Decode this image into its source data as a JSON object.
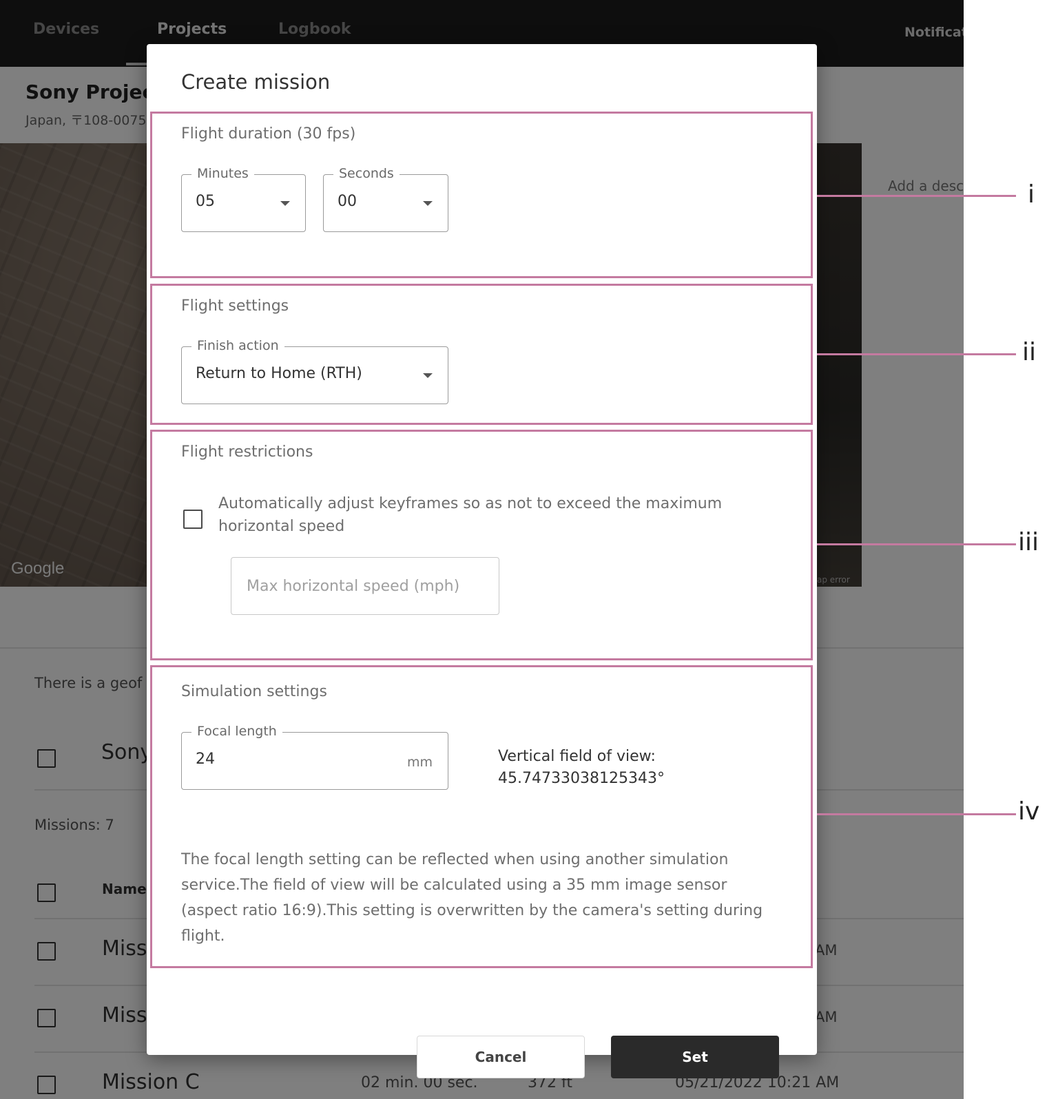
{
  "nav": {
    "tabs": [
      {
        "label": "Devices"
      },
      {
        "label": "Projects"
      },
      {
        "label": "Logbook"
      }
    ],
    "notifications": "Notificat"
  },
  "project": {
    "title": "Sony Project",
    "address": "Japan, 〒108-0075",
    "add_description": "Add a desc",
    "map_google": "Google",
    "map_error": "ap error"
  },
  "background_list": {
    "geofence_notice": "There is a geof",
    "sony_row": "Sony",
    "missions_count": "Missions: 7",
    "name_header": "Name",
    "rows": [
      {
        "name": "Miss",
        "time_suffix": "AM"
      },
      {
        "name": "Miss",
        "time_suffix": "AM"
      },
      {
        "name": "Mission C",
        "duration": "02 min. 00 sec.",
        "altitude": "372 ft",
        "date": "05/21/2022 10:21 AM"
      }
    ]
  },
  "dialog": {
    "title": "Create mission",
    "flight_duration": {
      "title": "Flight duration (30 fps)",
      "minutes_label": "Minutes",
      "minutes_value": "05",
      "seconds_label": "Seconds",
      "seconds_value": "00"
    },
    "flight_settings": {
      "title": "Flight settings",
      "finish_action_label": "Finish action",
      "finish_action_value": "Return to Home (RTH)"
    },
    "flight_restrictions": {
      "title": "Flight restrictions",
      "adjust_checkbox_label": "Automatically adjust keyframes so as not to exceed the maximum horizontal speed",
      "adjust_checked": false,
      "max_speed_placeholder": "Max horizontal speed (mph)"
    },
    "simulation_settings": {
      "title": "Simulation settings",
      "focal_length_label": "Focal length",
      "focal_length_value": "24",
      "focal_length_unit": "mm",
      "vfov_label": "Vertical field of view:",
      "vfov_value": "45.74733038125343°",
      "note": "The focal length setting can be reflected when using another simulation service.The field of view will be calculated using a 35 mm image sensor (aspect ratio 16:9).This setting is overwritten by the camera's setting during flight."
    },
    "buttons": {
      "cancel": "Cancel",
      "set": "Set"
    }
  },
  "callouts": [
    "i",
    "ii",
    "iii",
    "iv"
  ],
  "colors": {
    "callout": "#c47aa0",
    "nav_bg": "#1c1c1c",
    "primary_button": "#2a2a2a"
  }
}
